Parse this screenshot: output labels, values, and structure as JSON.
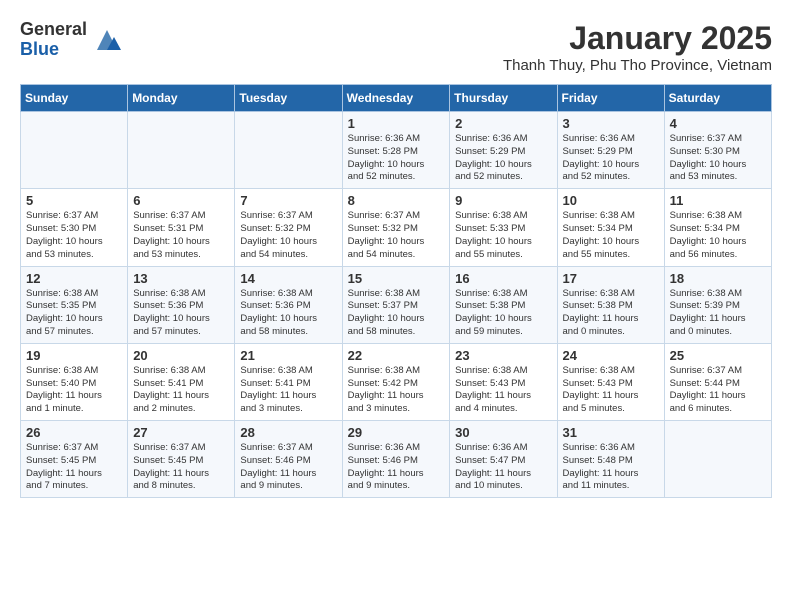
{
  "header": {
    "logo": {
      "general": "General",
      "blue": "Blue"
    },
    "title": "January 2025",
    "subtitle": "Thanh Thuy, Phu Tho Province, Vietnam"
  },
  "calendar": {
    "days_of_week": [
      "Sunday",
      "Monday",
      "Tuesday",
      "Wednesday",
      "Thursday",
      "Friday",
      "Saturday"
    ],
    "weeks": [
      [
        {
          "day": "",
          "info": ""
        },
        {
          "day": "",
          "info": ""
        },
        {
          "day": "",
          "info": ""
        },
        {
          "day": "1",
          "info": "Sunrise: 6:36 AM\nSunset: 5:28 PM\nDaylight: 10 hours\nand 52 minutes."
        },
        {
          "day": "2",
          "info": "Sunrise: 6:36 AM\nSunset: 5:29 PM\nDaylight: 10 hours\nand 52 minutes."
        },
        {
          "day": "3",
          "info": "Sunrise: 6:36 AM\nSunset: 5:29 PM\nDaylight: 10 hours\nand 52 minutes."
        },
        {
          "day": "4",
          "info": "Sunrise: 6:37 AM\nSunset: 5:30 PM\nDaylight: 10 hours\nand 53 minutes."
        }
      ],
      [
        {
          "day": "5",
          "info": "Sunrise: 6:37 AM\nSunset: 5:30 PM\nDaylight: 10 hours\nand 53 minutes."
        },
        {
          "day": "6",
          "info": "Sunrise: 6:37 AM\nSunset: 5:31 PM\nDaylight: 10 hours\nand 53 minutes."
        },
        {
          "day": "7",
          "info": "Sunrise: 6:37 AM\nSunset: 5:32 PM\nDaylight: 10 hours\nand 54 minutes."
        },
        {
          "day": "8",
          "info": "Sunrise: 6:37 AM\nSunset: 5:32 PM\nDaylight: 10 hours\nand 54 minutes."
        },
        {
          "day": "9",
          "info": "Sunrise: 6:38 AM\nSunset: 5:33 PM\nDaylight: 10 hours\nand 55 minutes."
        },
        {
          "day": "10",
          "info": "Sunrise: 6:38 AM\nSunset: 5:34 PM\nDaylight: 10 hours\nand 55 minutes."
        },
        {
          "day": "11",
          "info": "Sunrise: 6:38 AM\nSunset: 5:34 PM\nDaylight: 10 hours\nand 56 minutes."
        }
      ],
      [
        {
          "day": "12",
          "info": "Sunrise: 6:38 AM\nSunset: 5:35 PM\nDaylight: 10 hours\nand 57 minutes."
        },
        {
          "day": "13",
          "info": "Sunrise: 6:38 AM\nSunset: 5:36 PM\nDaylight: 10 hours\nand 57 minutes."
        },
        {
          "day": "14",
          "info": "Sunrise: 6:38 AM\nSunset: 5:36 PM\nDaylight: 10 hours\nand 58 minutes."
        },
        {
          "day": "15",
          "info": "Sunrise: 6:38 AM\nSunset: 5:37 PM\nDaylight: 10 hours\nand 58 minutes."
        },
        {
          "day": "16",
          "info": "Sunrise: 6:38 AM\nSunset: 5:38 PM\nDaylight: 10 hours\nand 59 minutes."
        },
        {
          "day": "17",
          "info": "Sunrise: 6:38 AM\nSunset: 5:38 PM\nDaylight: 11 hours\nand 0 minutes."
        },
        {
          "day": "18",
          "info": "Sunrise: 6:38 AM\nSunset: 5:39 PM\nDaylight: 11 hours\nand 0 minutes."
        }
      ],
      [
        {
          "day": "19",
          "info": "Sunrise: 6:38 AM\nSunset: 5:40 PM\nDaylight: 11 hours\nand 1 minute."
        },
        {
          "day": "20",
          "info": "Sunrise: 6:38 AM\nSunset: 5:41 PM\nDaylight: 11 hours\nand 2 minutes."
        },
        {
          "day": "21",
          "info": "Sunrise: 6:38 AM\nSunset: 5:41 PM\nDaylight: 11 hours\nand 3 minutes."
        },
        {
          "day": "22",
          "info": "Sunrise: 6:38 AM\nSunset: 5:42 PM\nDaylight: 11 hours\nand 3 minutes."
        },
        {
          "day": "23",
          "info": "Sunrise: 6:38 AM\nSunset: 5:43 PM\nDaylight: 11 hours\nand 4 minutes."
        },
        {
          "day": "24",
          "info": "Sunrise: 6:38 AM\nSunset: 5:43 PM\nDaylight: 11 hours\nand 5 minutes."
        },
        {
          "day": "25",
          "info": "Sunrise: 6:37 AM\nSunset: 5:44 PM\nDaylight: 11 hours\nand 6 minutes."
        }
      ],
      [
        {
          "day": "26",
          "info": "Sunrise: 6:37 AM\nSunset: 5:45 PM\nDaylight: 11 hours\nand 7 minutes."
        },
        {
          "day": "27",
          "info": "Sunrise: 6:37 AM\nSunset: 5:45 PM\nDaylight: 11 hours\nand 8 minutes."
        },
        {
          "day": "28",
          "info": "Sunrise: 6:37 AM\nSunset: 5:46 PM\nDaylight: 11 hours\nand 9 minutes."
        },
        {
          "day": "29",
          "info": "Sunrise: 6:36 AM\nSunset: 5:46 PM\nDaylight: 11 hours\nand 9 minutes."
        },
        {
          "day": "30",
          "info": "Sunrise: 6:36 AM\nSunset: 5:47 PM\nDaylight: 11 hours\nand 10 minutes."
        },
        {
          "day": "31",
          "info": "Sunrise: 6:36 AM\nSunset: 5:48 PM\nDaylight: 11 hours\nand 11 minutes."
        },
        {
          "day": "",
          "info": ""
        }
      ]
    ]
  }
}
